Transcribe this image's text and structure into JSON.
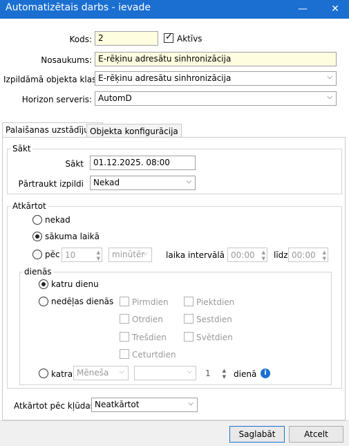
{
  "window": {
    "title": "Automatizētais darbs - ievade",
    "minimize": "—",
    "close": "✕"
  },
  "header": {
    "code_label": "Kods:",
    "code_value": "2",
    "active_label": "Aktīvs",
    "name_label": "Nosaukums:",
    "name_value": "E-rēķinu adresātu sinhronizācija",
    "class_label": "Izpildāmā objekta klase:",
    "class_value": "E-rēķinu adresātu sinhronizācija",
    "server_label": "Horizon serveris:",
    "server_value": "AutomD"
  },
  "tabs": [
    {
      "label": "Palaišanas uzstādījumi",
      "active": true
    },
    {
      "label": "Objekta konfigurācija",
      "active": false
    }
  ],
  "start": {
    "group_label": "Sākt",
    "start_label": "Sākt",
    "start_value": "01.12.2025. 08:00",
    "stop_label": "Pārtraukt izpildi",
    "stop_value": "Nekad"
  },
  "repeat": {
    "group_label": "Atkārtot",
    "never_label": "nekad",
    "at_start_label": "sākuma laikā",
    "after_label": "pēc",
    "interval_value": "10",
    "unit_value": "minūtēr",
    "interval_text": "laika intervālā no",
    "from_value": "00:00",
    "to_label": "līdz",
    "to_value": "00:00",
    "selected": "at_start"
  },
  "days": {
    "group_label": "dienās",
    "every_day_label": "katru dienu",
    "weekdays_label": "nedēļas dienās",
    "weekdays": [
      "Pirmdien",
      "Otrdien",
      "Trešdien",
      "Ceturtdien",
      "Piektdien",
      "Sestdien",
      "Svētdien"
    ],
    "every_label": "katra",
    "month_value": "Mēneša",
    "day_combo_value": "",
    "day_number": "1",
    "day_suffix": "dienā",
    "selected": "every_day"
  },
  "retry": {
    "label": "Atkārtot pēc kļūdas",
    "value": "Neatkārtot"
  },
  "buttons": {
    "save": "Saglabāt",
    "cancel": "Atcelt"
  },
  "colors": {
    "accent": "#1a6fd1",
    "info": "#1a6fd1",
    "input_highlight": "#fffde0"
  }
}
